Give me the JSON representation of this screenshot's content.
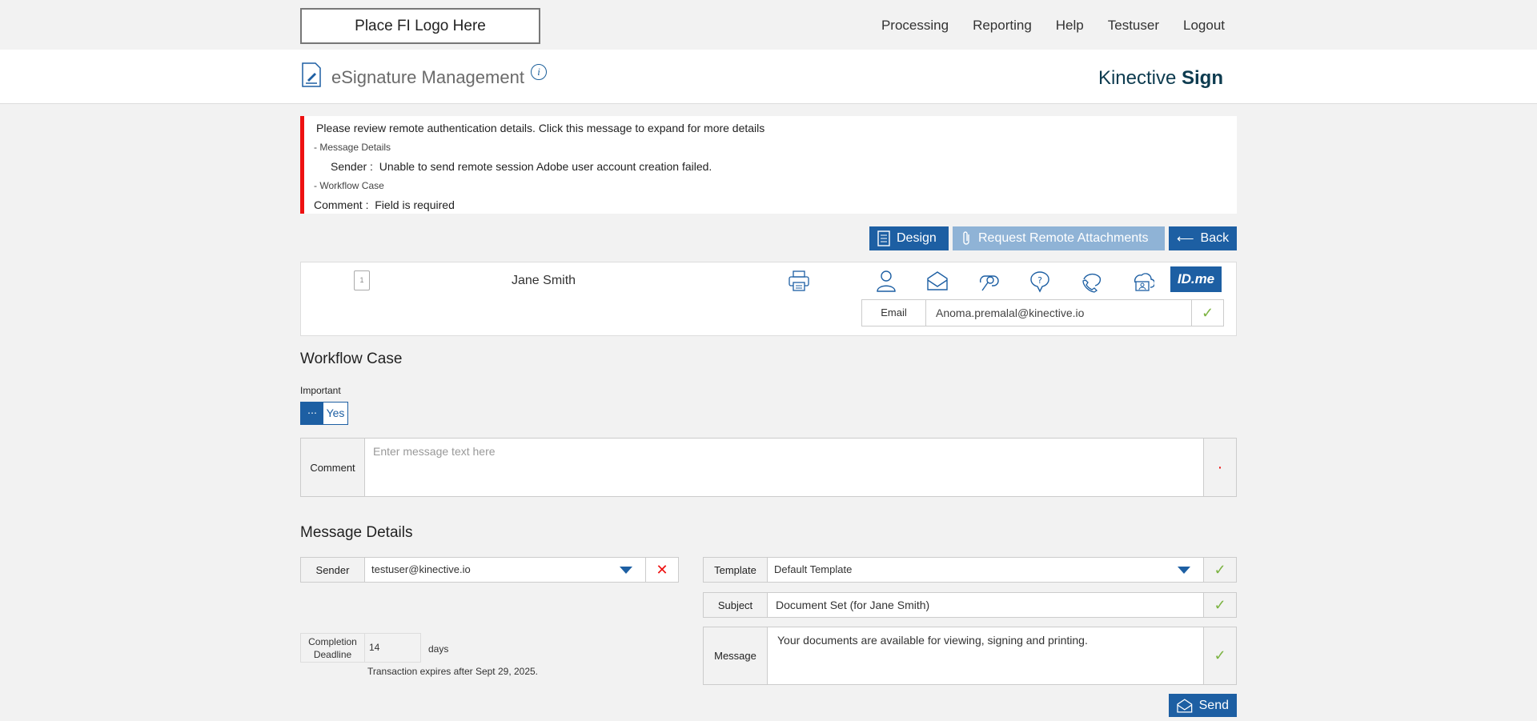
{
  "topbar": {
    "logo_placeholder": "Place FI Logo Here",
    "nav": [
      "Processing",
      "Reporting",
      "Help",
      "Testuser",
      "Logout"
    ]
  },
  "header": {
    "title": "eSignature Management",
    "info": "i",
    "brand_light": "Kinective",
    "brand_bold": "Sign"
  },
  "alert": {
    "headline": "Please review remote authentication details. Click this message to expand for more details",
    "group1": "- Message Details",
    "item1_label": "Sender :",
    "item1_text": "Unable to send remote session Adobe user account creation failed.",
    "group2": "- Workflow Case",
    "item2_label": "Comment :",
    "item2_text": "Field is required",
    "accent_color": "#e11111"
  },
  "actions": {
    "design": "Design",
    "request_attachments": "Request Remote Attachments",
    "back": "Back"
  },
  "recipient": {
    "page_number": "1",
    "name": "Jane Smith",
    "auth_icons": [
      "person-icon",
      "envelope-icon",
      "key-icon",
      "shield-question-icon",
      "phone-icon",
      "cloud-id-icon"
    ],
    "idme_label": "ID.me",
    "email_label": "Email",
    "email_value": "Anoma.premalal@kinective.io",
    "check": "✓"
  },
  "workflow": {
    "title": "Workflow Case",
    "important_label": "Important",
    "toggle_knob": "⋯",
    "toggle_value": "Yes",
    "comment_label": "Comment",
    "comment_placeholder": "Enter message text here",
    "required_marker": "·"
  },
  "message": {
    "title": "Message Details",
    "sender_label": "Sender",
    "sender_value": "testuser@kinective.io",
    "clear": "✕",
    "template_label": "Template",
    "template_value": "Default Template",
    "subject_label": "Subject",
    "subject_value": "Document Set (for Jane Smith)",
    "message_label": "Message",
    "message_value": "Your documents are available for viewing, signing and printing.",
    "check": "✓",
    "deadline_label": "Completion Deadline",
    "deadline_value": "14",
    "deadline_unit": "days",
    "expires_text": "Transaction expires after Sept 29, 2025.",
    "send": "Send"
  },
  "colors": {
    "primary": "#1d5fa3",
    "primary_disabled": "#8fb3d6",
    "success": "#7cb342",
    "error": "#e11111"
  }
}
